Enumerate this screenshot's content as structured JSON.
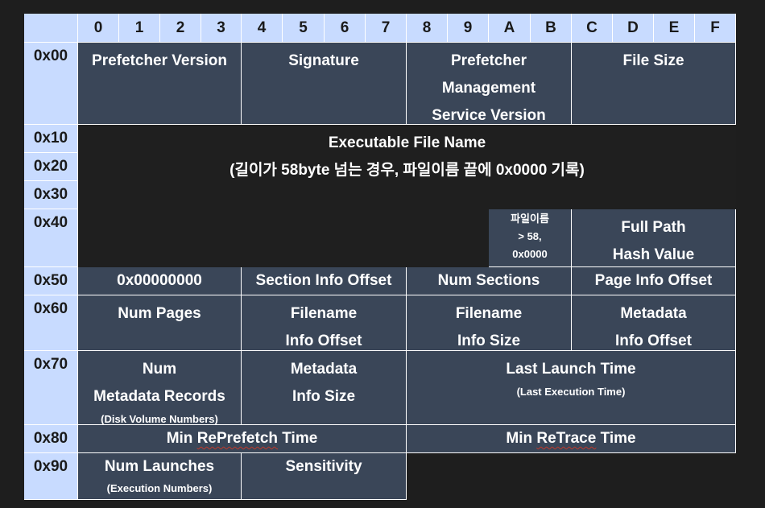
{
  "columns": [
    "0",
    "1",
    "2",
    "3",
    "4",
    "5",
    "6",
    "7",
    "8",
    "9",
    "A",
    "B",
    "C",
    "D",
    "E",
    "F"
  ],
  "rows": [
    "0x00",
    "0x10",
    "0x20",
    "0x30",
    "0x40",
    "0x50",
    "0x60",
    "0x70",
    "0x80",
    "0x90"
  ],
  "fields": {
    "prefetcher_version": [
      "Prefetcher Version"
    ],
    "signature": [
      "Signature"
    ],
    "pms_version": [
      "Prefetcher",
      "Management",
      "Service Version"
    ],
    "file_size": [
      "File Size"
    ],
    "exe_name": [
      "Executable File Name",
      "(길이가 58byte 넘는 경우, 파일이름 끝에 0x0000 기록)"
    ],
    "filename_note": [
      "파일이름",
      "> 58,",
      "0x0000"
    ],
    "full_path_hash": [
      "Full Path",
      "Hash Value"
    ],
    "zero": [
      "0x00000000"
    ],
    "section_info_offset": [
      "Section Info Offset"
    ],
    "num_sections": [
      "Num Sections"
    ],
    "page_info_offset": [
      "Page Info Offset"
    ],
    "num_pages": [
      "Num Pages"
    ],
    "filename_info_offset": [
      "Filename",
      "Info Offset"
    ],
    "filename_info_size": [
      "Filename",
      "Info Size"
    ],
    "metadata_info_offset": [
      "Metadata",
      "Info Offset"
    ],
    "num_metadata_records": [
      "Num",
      "Metadata Records",
      "(Disk Volume Numbers)"
    ],
    "metadata_info_size": [
      "Metadata",
      "Info Size"
    ],
    "last_launch_time": [
      "Last Launch Time",
      "(Last Execution Time)"
    ],
    "min_reprefetch_time": [
      "Min ",
      "RePrefetch",
      " Time"
    ],
    "min_retrace_time": [
      "Min ",
      "ReTrace",
      " Time"
    ],
    "num_launches": [
      "Num Launches",
      "(Execution Numbers)"
    ],
    "sensitivity": [
      "Sensitivity"
    ]
  }
}
